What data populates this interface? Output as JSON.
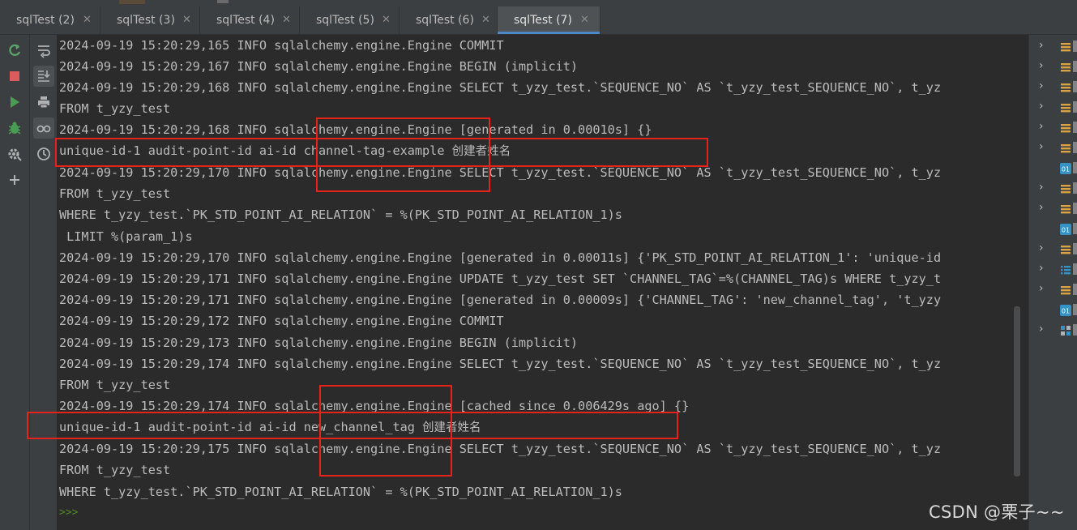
{
  "tabs": [
    {
      "label": "sqlTest (2)",
      "active": false
    },
    {
      "label": "sqlTest (3)",
      "active": false
    },
    {
      "label": "sqlTest (4)",
      "active": false
    },
    {
      "label": "sqlTest (5)",
      "active": false
    },
    {
      "label": "sqlTest (6)",
      "active": false
    },
    {
      "label": "sqlTest (7)",
      "active": true
    }
  ],
  "tab_close_glyph": "✕",
  "left_toolbar": [
    "rerun-icon",
    "stop-icon",
    "run-icon",
    "debug-icon",
    "settings-icon",
    "add-icon"
  ],
  "left_toolbar2": [
    "soft-wrap-icon",
    "scroll-to-end-icon",
    "print-icon",
    "view-variables-icon",
    "history-icon"
  ],
  "console": {
    "lines": [
      "2024-09-19 15:20:29,165 INFO sqlalchemy.engine.Engine COMMIT",
      "2024-09-19 15:20:29,167 INFO sqlalchemy.engine.Engine BEGIN (implicit)",
      "2024-09-19 15:20:29,168 INFO sqlalchemy.engine.Engine SELECT t_yzy_test.`SEQUENCE_NO` AS `t_yzy_test_SEQUENCE_NO`, t_yz",
      "FROM t_yzy_test",
      "2024-09-19 15:20:29,168 INFO sqlalchemy.engine.Engine [generated in 0.00010s] {}",
      "unique-id-1 audit-point-id ai-id channel-tag-example ",
      "2024-09-19 15:20:29,170 INFO sqlalchemy.engine.Engine SELECT t_yzy_test.`SEQUENCE_NO` AS `t_yzy_test_SEQUENCE_NO`, t_yz",
      "FROM t_yzy_test",
      "WHERE t_yzy_test.`PK_STD_POINT_AI_RELATION` = %(PK_STD_POINT_AI_RELATION_1)s",
      " LIMIT %(param_1)s",
      "2024-09-19 15:20:29,170 INFO sqlalchemy.engine.Engine [generated in 0.00011s] {'PK_STD_POINT_AI_RELATION_1': 'unique-id",
      "2024-09-19 15:20:29,171 INFO sqlalchemy.engine.Engine UPDATE t_yzy_test SET `CHANNEL_TAG`=%(CHANNEL_TAG)s WHERE t_yzy_t",
      "2024-09-19 15:20:29,171 INFO sqlalchemy.engine.Engine [generated in 0.00009s] {'CHANNEL_TAG': 'new_channel_tag', 't_yzy",
      "2024-09-19 15:20:29,172 INFO sqlalchemy.engine.Engine COMMIT",
      "2024-09-19 15:20:29,173 INFO sqlalchemy.engine.Engine BEGIN (implicit)",
      "2024-09-19 15:20:29,174 INFO sqlalchemy.engine.Engine SELECT t_yzy_test.`SEQUENCE_NO` AS `t_yzy_test_SEQUENCE_NO`, t_yz",
      "FROM t_yzy_test",
      "2024-09-19 15:20:29,174 INFO sqlalchemy.engine.Engine [cached since 0.006429s ago] {}",
      "unique-id-1 audit-point-id ai-id new_channel_tag ",
      "2024-09-19 15:20:29,175 INFO sqlalchemy.engine.Engine SELECT t_yzy_test.`SEQUENCE_NO` AS `t_yzy_test_SEQUENCE_NO`, t_yz",
      "FROM t_yzy_test",
      "WHERE t_yzy_test.`PK_STD_POINT_AI_RELATION` = %(PK_STD_POINT_AI_RELATION_1)s"
    ],
    "creator_name_1": "创建者姓名",
    "creator_name_2": "创建者姓名",
    "prompt": ">>>"
  },
  "right_panel_items": [
    {
      "icon": "chevron",
      "type": "field"
    },
    {
      "icon": "chevron",
      "type": "field"
    },
    {
      "icon": "chevron",
      "type": "field"
    },
    {
      "icon": "chevron",
      "type": "field"
    },
    {
      "icon": "chevron",
      "type": "field"
    },
    {
      "icon": "chevron",
      "type": "field"
    },
    {
      "icon": "none",
      "type": "int"
    },
    {
      "icon": "chevron",
      "type": "field"
    },
    {
      "icon": "chevron",
      "type": "field"
    },
    {
      "icon": "none",
      "type": "int"
    },
    {
      "icon": "chevron",
      "type": "field"
    },
    {
      "icon": "chevron",
      "type": "list"
    },
    {
      "icon": "chevron",
      "type": "field"
    },
    {
      "icon": "none",
      "type": "int"
    },
    {
      "icon": "chevron",
      "type": "grid"
    }
  ],
  "watermark": "CSDN @栗子~~",
  "colors": {
    "accent": "#4a88c7",
    "annotation": "#e5231b",
    "console_bg": "#2b2b2b",
    "text": "#bbbbbb",
    "prompt": "#4d8a1f"
  }
}
